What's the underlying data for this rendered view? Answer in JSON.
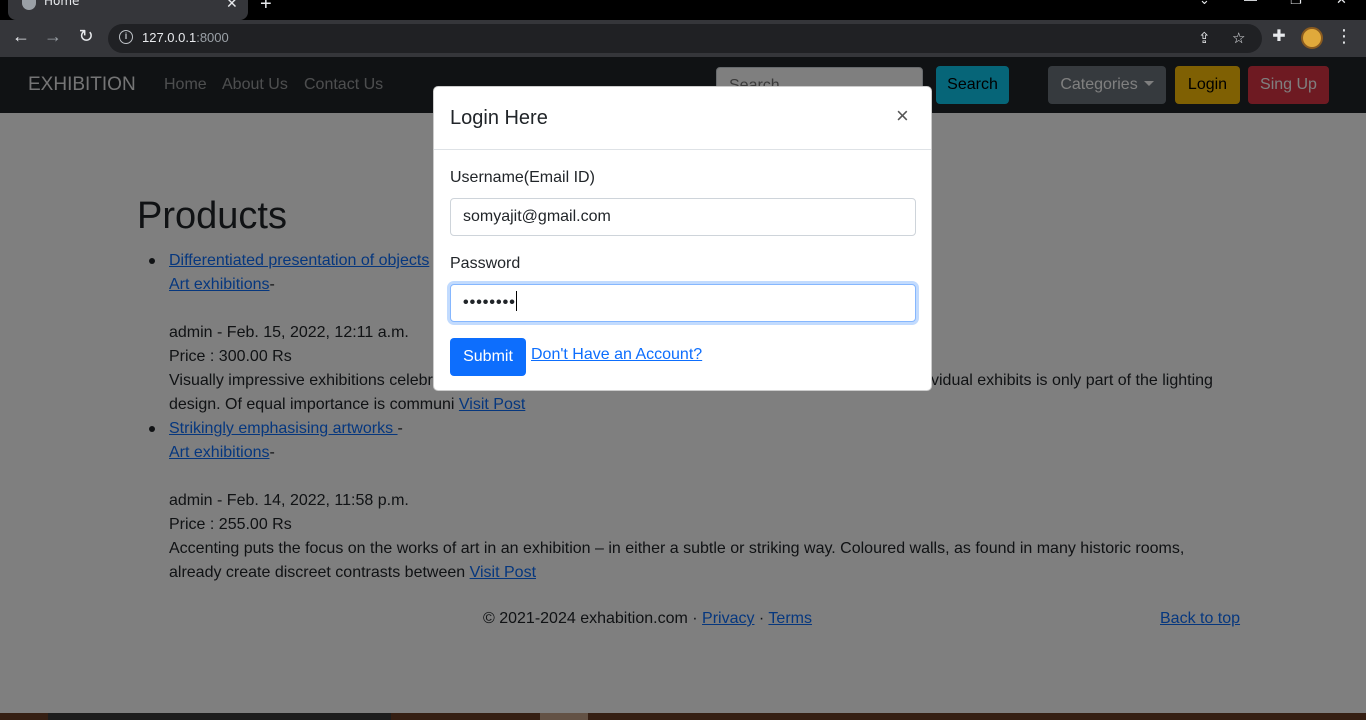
{
  "browser": {
    "tab_title": "Home",
    "tab_close": "✕",
    "new_tab": "+",
    "url_host": "127.0.0.1",
    "url_port": ":8000",
    "info": "i",
    "icons": [
      "back-arrow-icon",
      "forward-arrow-icon",
      "reload-icon",
      "share-icon",
      "star-icon",
      "extensions-icon",
      "profile-avatar",
      "menu-kebab-icon"
    ]
  },
  "navbar": {
    "brand": "EXHIBITION",
    "links": [
      "Home",
      "About Us",
      "Contact Us"
    ],
    "search_placeholder": "Search",
    "search_button": "Search",
    "categories_button": "Categories",
    "login_button": "Login",
    "signup_button": "Sing Up"
  },
  "main": {
    "heading": "Products",
    "items": [
      {
        "title": "Differentiated presentation of objects",
        "category": "Art exhibitions",
        "meta": "admin - Feb. 15, 2022, 12:11 a.m.",
        "price": "Price : 300.00 Rs",
        "excerpt_line1": "Visually impressive exhibitions celebra",
        "excerpt_line1_right": "vidual exhibits is only part of the lighting",
        "excerpt_line2": "design. Of equal importance is communi",
        "visit": "Visit Post"
      },
      {
        "title": "Strikingly emphasising artworks ",
        "category": "Art exhibitions",
        "meta": "admin - Feb. 14, 2022, 11:58 p.m.",
        "price": "Price : 255.00 Rs",
        "excerpt_line1": "Accenting puts the focus on the works of art in an exhibition – in either a subtle or striking way. Coloured walls, as found in many historic rooms,",
        "excerpt_line2": "already create discreet contrasts between",
        "visit": "Visit Post"
      }
    ],
    "dash": "-"
  },
  "footer": {
    "copyright": "© 2021-2024 exhabition.com · ",
    "privacy": "Privacy",
    "dot": " · ",
    "terms": "Terms",
    "back_to_top": "Back to top"
  },
  "modal": {
    "title": "Login Here",
    "close": "×",
    "username_label": "Username(Email ID)",
    "username_value": "somyajit@gmail.com",
    "password_label": "Password",
    "password_value": "••••••••",
    "submit": "Submit",
    "no_account": "Don't Have an Account?"
  },
  "colors": {
    "navbar_bg": "#212529",
    "primary": "#0d6efd",
    "info": "#0dcaf0",
    "warning": "#ffc107",
    "danger": "#dc3545",
    "secondary": "#6c757d"
  }
}
